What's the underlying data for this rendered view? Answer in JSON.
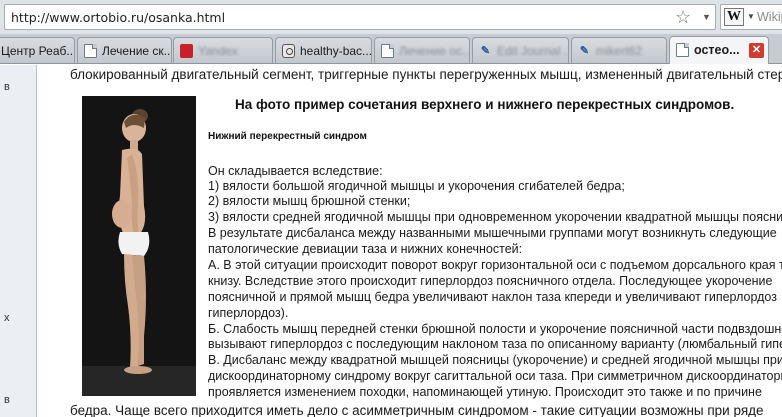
{
  "address_bar": {
    "url": "http://www.ortobio.ru/osanka.html"
  },
  "search_box": {
    "engine_letter": "W",
    "text": "Wikipe"
  },
  "tabs": [
    {
      "label": "Центр Реаб...",
      "icon": "page"
    },
    {
      "label": "Лечение ск...",
      "icon": "doc-icon"
    },
    {
      "label": "Yandex",
      "icon": "red-icon"
    },
    {
      "label": "healthy-bac...",
      "icon": "camera-icon"
    },
    {
      "label": "Лечение ос...",
      "icon": "doc-icon"
    },
    {
      "label": "Edit Journal ...",
      "icon": "pin-icon"
    },
    {
      "label": "mikert62",
      "icon": "pin-icon"
    },
    {
      "label": "остео...",
      "icon": "doc-icon",
      "active": true
    }
  ],
  "sidebar": {
    "chars": [
      "в",
      "х",
      "в"
    ]
  },
  "page": {
    "top_line": "блокированный двигательный сегмент, триггерные пункты перегруженных мышц, измененный двигательный стереотип",
    "headline": "На фото пример сочетания верхнего и нижнего перекрестных синдромов.",
    "subhead": "Нижний перекрестный синдром",
    "paragraphs": [
      "Он складывается вследствие:",
      "1) вялости большой ягодичной мышцы и укорочения сгибателей бедра;",
      "2) вялости мышц брюшной стенки;",
      "3) вялости средней ягодичной мышцы при одновременном укорочении квадратной мышцы поясницы.",
      "В результате дисбаланса между названными мышечными группами могут возникнуть следующие",
      "патологические девиации таза и нижних конечностей:",
      "А. В этой ситуации происходит поворот вокруг горизонтальной оси с подъемом дорсального края таза",
      "книзу. Вследствие этого происходит гиперлордоз поясничного отдела. Последующее укорочение",
      "поясничной и прямой мышц бедра увеличивают наклон таза кпереди и увеличивают гиперлордоз",
      "гиперлордоз).",
      "Б. Слабость мышц передней стенки брюшной полости и укорочение поясничной части подвздошной",
      "вызывают гиперлордоз с последующим наклоном таза по описанному варианту (люмбальный гиперлордоз).",
      "В. Дисбаланс между квадратной мышцей поясницы (укорочение) и средней ягодичной мышцы приводит к",
      "дискоординаторному синдрому вокруг сагиттальной оси таза. При симметричном дискоординаторном",
      "проявляется изменением походки, напоминающей утиную. Происходит это также и по причине",
      "бедра. Чаще всего приходится иметь дело с асимметричным синдромом - такие ситуации возможны при ряде"
    ]
  }
}
